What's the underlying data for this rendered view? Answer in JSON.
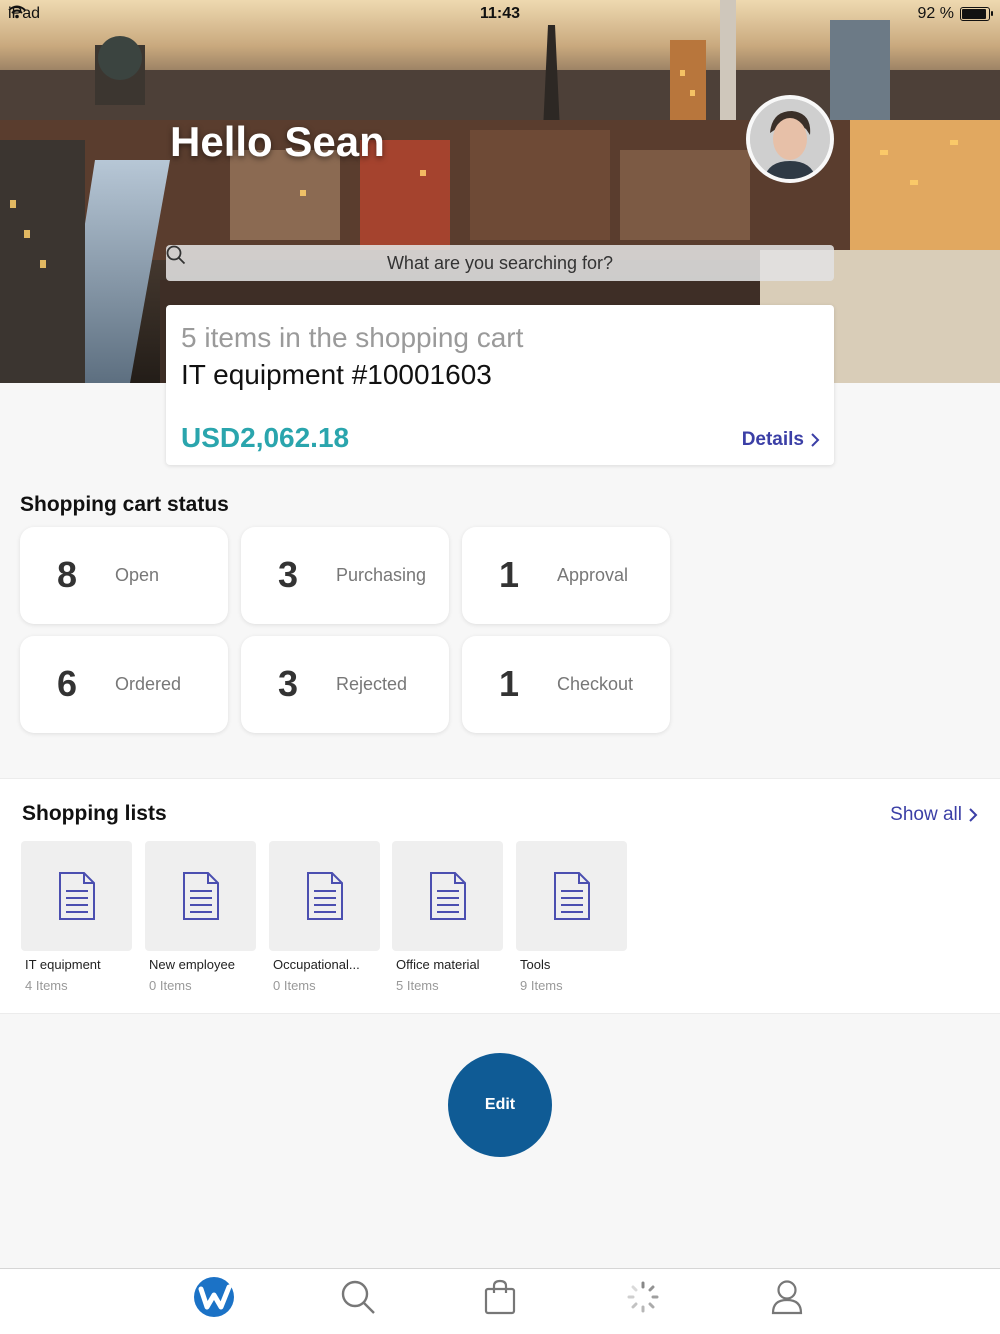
{
  "status_bar": {
    "device": "iPad",
    "time": "11:43",
    "battery": "92 %",
    "battery_level": 0.92
  },
  "header": {
    "greeting": "Hello Sean"
  },
  "search": {
    "placeholder": "What are you searching for?"
  },
  "cart": {
    "count_text": "5 items in the shopping cart",
    "title": "IT equipment #10001603",
    "price": "USD2,062.18",
    "details_label": "Details"
  },
  "status": {
    "title": "Shopping cart status",
    "tiles": [
      {
        "count": "8",
        "label": "Open"
      },
      {
        "count": "3",
        "label": "Purchasing"
      },
      {
        "count": "1",
        "label": "Approval"
      },
      {
        "count": "6",
        "label": "Ordered"
      },
      {
        "count": "3",
        "label": "Rejected"
      },
      {
        "count": "1",
        "label": "Checkout"
      }
    ]
  },
  "lists": {
    "title": "Shopping lists",
    "show_all_label": "Show all",
    "items": [
      {
        "name": "IT equipment",
        "count": "4 Items"
      },
      {
        "name": "New employee",
        "count": "0 Items"
      },
      {
        "name": "Occupational...",
        "count": "0 Items"
      },
      {
        "name": "Office material",
        "count": "5 Items"
      },
      {
        "name": "Tools",
        "count": "9 Items"
      }
    ]
  },
  "edit_label": "Edit",
  "tabbar": {
    "items": [
      {
        "icon": "home-logo-icon"
      },
      {
        "icon": "search-icon"
      },
      {
        "icon": "shopping-bag-icon"
      },
      {
        "icon": "loading-spinner-icon"
      },
      {
        "icon": "profile-icon"
      }
    ]
  },
  "colors": {
    "accent": "#3b3fa6",
    "price": "#2aa5ad",
    "edit": "#0f5b95"
  }
}
